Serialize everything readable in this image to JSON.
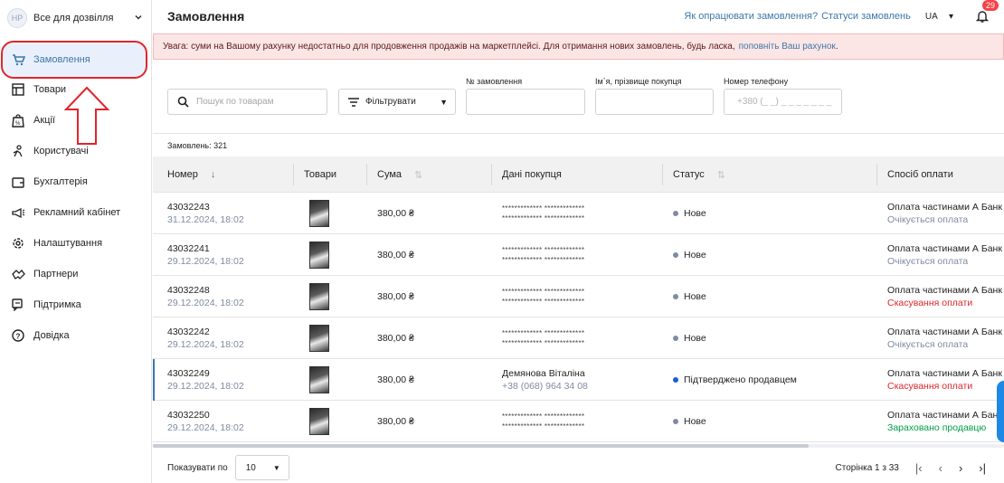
{
  "store": {
    "initials": "НР",
    "name": "Все для дозвілля"
  },
  "sidebar": {
    "items": [
      {
        "label": "Замовлення",
        "icon": "cart-icon"
      },
      {
        "label": "Товари",
        "icon": "grid-icon"
      },
      {
        "label": "Акції",
        "icon": "sale-bag-icon"
      },
      {
        "label": "Користувачі",
        "icon": "users-icon"
      },
      {
        "label": "Бухгалтерія",
        "icon": "wallet-icon"
      },
      {
        "label": "Рекламний кабінет",
        "icon": "megaphone-icon"
      },
      {
        "label": "Налаштування",
        "icon": "gear-icon"
      },
      {
        "label": "Партнери",
        "icon": "handshake-icon"
      },
      {
        "label": "Підтримка",
        "icon": "chat-icon"
      },
      {
        "label": "Довідка",
        "icon": "question-icon"
      }
    ]
  },
  "header": {
    "title": "Замовлення",
    "link_how": "Як опрацювати замовлення?",
    "link_statuses": "Статуси замовлень",
    "lang": "UA",
    "notifications": "29"
  },
  "warning": {
    "text": "Увага: суми на Вашому рахунку недостатньо для продовження продажів на маркетплейсі. Для отримання нових замовлень, будь ласка,",
    "link": "поповніть Ваш рахунок",
    "end": "."
  },
  "filters": {
    "search_placeholder": "Пошук по товарам",
    "filter_label": "Фільтрувати",
    "order_no_label": "№ замовлення",
    "buyer_label": "Ім`я, прізвище покупця",
    "phone_label": "Номер телефону",
    "phone_placeholder": "+380 (_ _)  _ _ _  _ _  _ _"
  },
  "count_text": "Замовлень: 321",
  "table": {
    "headers": {
      "number": "Номер",
      "goods": "Товари",
      "sum": "Сума",
      "buyer": "Дані покупця",
      "status": "Статус",
      "payment": "Спосіб оплати"
    },
    "rows": [
      {
        "number": "43032243",
        "date": "31.12.2024, 18:02",
        "sum": "380,00 ₴",
        "buyer_line1": "************* *************",
        "buyer_line2": "************* *************",
        "status": "Нове",
        "payment": "Оплата частинами А Банк",
        "payment_state": "Очікується оплата"
      },
      {
        "number": "43032241",
        "date": "29.12.2024, 18:02",
        "sum": "380,00 ₴",
        "buyer_line1": "************* *************",
        "buyer_line2": "************* *************",
        "status": "Нове",
        "payment": "Оплата частинами А Банк",
        "payment_state": "Очікується оплата"
      },
      {
        "number": "43032248",
        "date": "29.12.2024, 18:02",
        "sum": "380,00 ₴",
        "buyer_line1": "************* *************",
        "buyer_line2": "************* *************",
        "status": "Нове",
        "payment": "Оплата частинами А Банк",
        "payment_state": "Скасування оплати"
      },
      {
        "number": "43032242",
        "date": "29.12.2024, 18:02",
        "sum": "380,00 ₴",
        "buyer_line1": "************* *************",
        "buyer_line2": "************* *************",
        "status": "Нове",
        "payment": "Оплата частинами А Банк",
        "payment_state": "Очікується оплата"
      },
      {
        "number": "43032249",
        "date": "29.12.2024, 18:02",
        "sum": "380,00 ₴",
        "buyer_line1": "Демянова Віталіна",
        "buyer_line2": "+38 (068) 964 34 08",
        "status": "Підтверджено продавцем",
        "payment": "Оплата частинами А Банк",
        "payment_state": "Скасування оплати"
      },
      {
        "number": "43032250",
        "date": "29.12.2024, 18:02",
        "sum": "380,00 ₴",
        "buyer_line1": "************* *************",
        "buyer_line2": "************* *************",
        "status": "Нове",
        "payment": "Оплата частинами А Банк",
        "payment_state": "Зараховано продавцю"
      }
    ]
  },
  "footer": {
    "per_page_label": "Показувати по",
    "per_page_value": "10",
    "page_info": "Сторінка 1 з 33"
  },
  "colors": {
    "accent": "#3e77aa",
    "status_new": "#7f8ba2",
    "status_confirmed": "#1e5bd6",
    "pay_wait": "#7f8ba2",
    "pay_cancel": "#e0262b",
    "pay_done": "#00a046"
  }
}
